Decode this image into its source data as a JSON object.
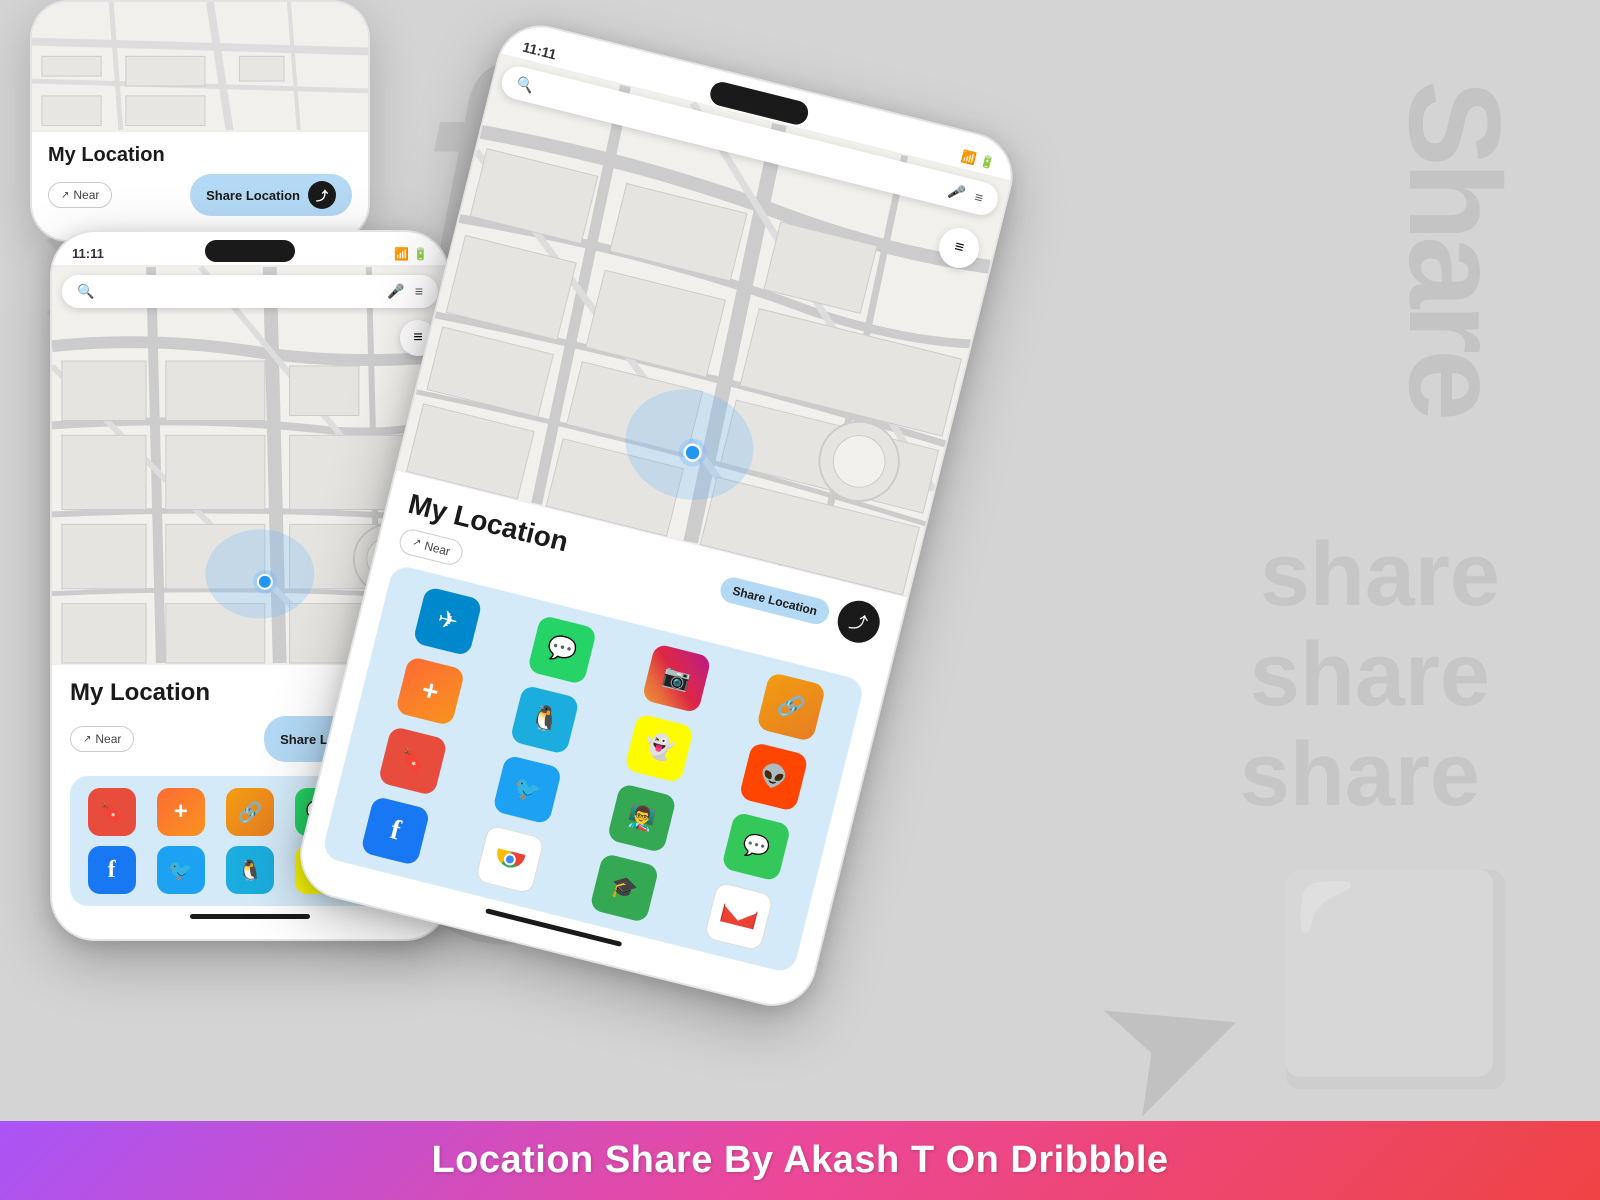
{
  "background_color": "#d0d0d0",
  "watermarks": {
    "f": "f",
    "share_vertical": "share",
    "share_bottom": "share",
    "whatsapp": "◯",
    "x": "✕",
    "arrow": "➤"
  },
  "phone_small_top": {
    "title": "My Location",
    "near_label": "Near",
    "share_label": "Share Location"
  },
  "phone_medium": {
    "status_time": "11:11",
    "title": "My Location",
    "near_label": "Near",
    "share_label": "Share Location",
    "search_placeholder": "",
    "apps": [
      {
        "name": "Bookmark",
        "emoji": "🔖",
        "style": "bookmark"
      },
      {
        "name": "Add",
        "emoji": "➕",
        "style": "add"
      },
      {
        "name": "Link",
        "emoji": "🔗",
        "style": "link"
      },
      {
        "name": "WhatsApp",
        "emoji": "💬",
        "style": "whatsapp"
      },
      {
        "name": "Telegram",
        "emoji": "✈️",
        "style": "telegram"
      },
      {
        "name": "Facebook",
        "emoji": "f",
        "style": "facebook"
      },
      {
        "name": "Twitter",
        "emoji": "🐦",
        "style": "twitter"
      },
      {
        "name": "QQ",
        "emoji": "🐧",
        "style": "qq"
      },
      {
        "name": "Snapchat",
        "emoji": "👻",
        "style": "snapchat"
      },
      {
        "name": "Instagram",
        "emoji": "📷",
        "style": "instagram"
      }
    ]
  },
  "phone_large": {
    "status_time": "11:11",
    "title": "My Location",
    "near_label": "Near",
    "share_label": "Share Location",
    "apps": [
      {
        "name": "Telegram",
        "emoji": "✈️",
        "style": "telegram"
      },
      {
        "name": "WhatsApp",
        "emoji": "💬",
        "style": "whatsapp"
      },
      {
        "name": "Instagram",
        "emoji": "📷",
        "style": "instagram"
      },
      {
        "name": "Link",
        "emoji": "🔗",
        "style": "link"
      },
      {
        "name": "Snapchat",
        "emoji": "👻",
        "style": "snapchat"
      },
      {
        "name": "Reddit",
        "emoji": "👽",
        "style": "reddit"
      },
      {
        "name": "Add",
        "emoji": "➕",
        "style": "add"
      },
      {
        "name": "QQ",
        "emoji": "🐧",
        "style": "qq"
      },
      {
        "name": "Bookmark",
        "emoji": "🔖",
        "style": "bookmark"
      },
      {
        "name": "Twitter",
        "emoji": "🐦",
        "style": "twitter"
      },
      {
        "name": "Google Classroom",
        "emoji": "👨‍🏫",
        "style": "google-classroom"
      },
      {
        "name": "Messages",
        "emoji": "💬",
        "style": "messages"
      },
      {
        "name": "Facebook",
        "emoji": "f",
        "style": "facebook"
      },
      {
        "name": "Chrome",
        "emoji": "🌐",
        "style": "chrome"
      },
      {
        "name": "Google Classroom2",
        "emoji": "🎓",
        "style": "google-classroom2"
      },
      {
        "name": "Gmail",
        "emoji": "M",
        "style": "gmail"
      }
    ]
  },
  "footer": {
    "text": "Location Share By Akash T On Dribbble"
  }
}
